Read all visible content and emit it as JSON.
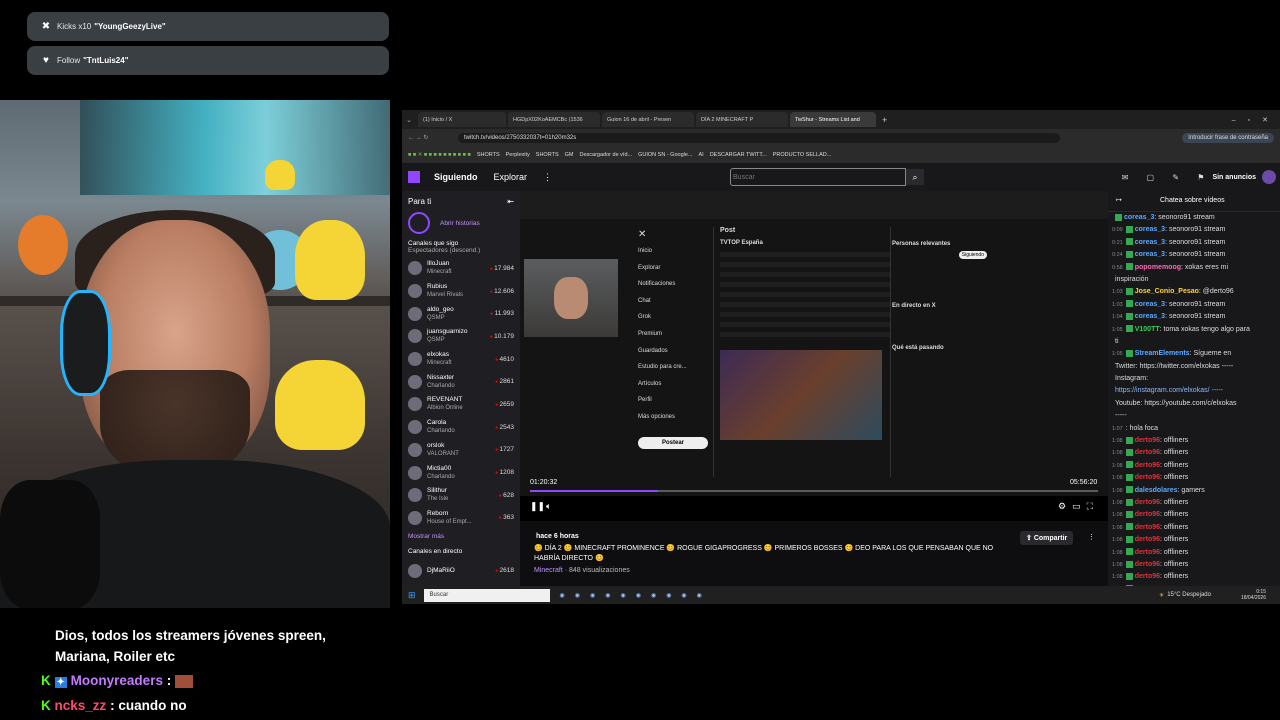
{
  "alerts": [
    {
      "icon": "x-circle-icon",
      "prefix": "Kicks x10",
      "user": "\"YoungGeezyLive\""
    },
    {
      "icon": "heart-icon",
      "prefix": "Follow",
      "user": "\"TntLuis24\""
    }
  ],
  "stream_chat": [
    {
      "text": "Dios, todos los streamers jóvenes spreen,"
    },
    {
      "text": "Mariana, Roiler etc"
    },
    {
      "user": "Moonyreaders",
      "sep": ":",
      "user_color": "#c27cff"
    },
    {
      "user": "ncks_zz",
      "sep": ":",
      "msg": "cuando no",
      "user_color": "#ff4a6d"
    }
  ],
  "browser": {
    "tabs": [
      "(1) Inicio / X",
      "HGDpX02KoAEMCBc (1536",
      "Guion 16 de abril - Presen",
      "DÍA 2 MINECRAFT P",
      "TwShur - Streams List and"
    ],
    "url": "twitch.tv/videos/2750332037t=01h20m32s",
    "password_btn": "Introducir frase de contraseña",
    "bookmarks": [
      "SHORTS",
      "Perplexity",
      "SHORTS",
      "GM",
      "Descargador de víd...",
      "GUION SN - Google...",
      "AI",
      "DESCARGAR TWITT...",
      "PRODUCTO SELLAD..."
    ]
  },
  "twitch": {
    "nav": {
      "following": "Siguiendo",
      "browse": "Explorar",
      "search_placeholder": "Buscar",
      "no_ads": "Sin anuncios"
    },
    "sidebar": {
      "for_you": "Para ti",
      "open_history": "Abrir historias",
      "followed": "Canales que sigo",
      "sort": "Espectadores (descend.)",
      "channels": [
        {
          "name": "IlloJuan",
          "game": "Minecraft",
          "viewers": "17.984"
        },
        {
          "name": "Rubius",
          "game": "Marvel Rivals",
          "viewers": "12.606"
        },
        {
          "name": "aldo_geo",
          "game": "QSMP",
          "viewers": "11.993"
        },
        {
          "name": "juansguarnizo",
          "game": "QSMP",
          "viewers": "10.179"
        },
        {
          "name": "elxokas",
          "game": "Minecraft",
          "viewers": "4610"
        },
        {
          "name": "Nissaxter",
          "game": "Charlando",
          "viewers": "2861"
        },
        {
          "name": "REVENANT",
          "game": "Albion Online",
          "viewers": "2659"
        },
        {
          "name": "Carola",
          "game": "Charlando",
          "viewers": "2543"
        },
        {
          "name": "orslok",
          "game": "VALORANT",
          "viewers": "1727"
        },
        {
          "name": "Mictia00",
          "game": "Charlando",
          "viewers": "1208"
        },
        {
          "name": "Silithur",
          "game": "The Isle",
          "viewers": "628"
        },
        {
          "name": "Reborn",
          "game": "House of Empt...",
          "viewers": "363"
        }
      ],
      "show_more": "Mostrar más",
      "live_channels": "Canales en directo",
      "live_first": {
        "name": "DjMaRiiO",
        "viewers": "2618"
      }
    },
    "player": {
      "current_time": "01:20:32",
      "duration": "05:56:20",
      "progress": 0.225
    },
    "video": {
      "age": "hace 6 horas",
      "title": "😊 DÍA 2 😊 MINECRAFT PROMINENCE 😊 ROGUE GIGAPROGRESS 😊 PRIMEROS BOSSES 😊 DEO PARA LOS QUE PENSABAN QUE NO HABRÍA DIRECTO 😊",
      "game": "Minecraft",
      "views": "· 848 visualizaciones",
      "share": "Compartir"
    },
    "xpage": {
      "menu": [
        "Inicio",
        "Explorar",
        "Notificaciones",
        "Chat",
        "Grok",
        "Premium",
        "Guardados",
        "Estudio para cre...",
        "Artículos",
        "Perfil",
        "Más opciones"
      ],
      "post_btn": "Postear",
      "post_header": "Post",
      "account": "TVTOP España",
      "relevant": "Personas relevantes",
      "follow": "Siguiendo",
      "live_on_x": "En directo en X",
      "whats_happening": "Qué está pasando"
    },
    "chat": {
      "title": "Chatea sobre vídeos",
      "lines": [
        {
          "time": "",
          "user": "coreas_3",
          "msg": ": seonoro91  stream",
          "color": "#5fa8ff"
        },
        {
          "time": "0:09",
          "user": "coreas_3",
          "msg": ": seonoro91  stream",
          "color": "#5fa8ff"
        },
        {
          "time": "0:21",
          "user": "coreas_3",
          "msg": ": seonoro91  stream",
          "color": "#5fa8ff"
        },
        {
          "time": "0:24",
          "user": "coreas_3",
          "msg": ": seonoro91  stream",
          "color": "#5fa8ff"
        },
        {
          "time": "0:58",
          "user": "popomemoog",
          "msg": ": xokas eres mi",
          "color": "#ff69b4"
        },
        {
          "time": "",
          "user": "",
          "msg": "inspiración",
          "color": "#ddd"
        },
        {
          "time": "1:03",
          "user": "Jose_Conio_Pesao",
          "msg": ": @derto96",
          "color": "#ffd23f"
        },
        {
          "time": "1:03",
          "user": "coreas_3",
          "msg": ": seonoro91  stream",
          "color": "#5fa8ff"
        },
        {
          "time": "1:04",
          "user": "coreas_3",
          "msg": ": seonoro91  stream",
          "color": "#5fa8ff"
        },
        {
          "time": "1:05",
          "user": "V100TT",
          "msg": ": toma xokas tengo algo para",
          "color": "#34d058"
        },
        {
          "time": "",
          "user": "",
          "msg": "ti",
          "color": "#ddd"
        },
        {
          "time": "1:05",
          "user": "StreamElements",
          "msg": ": Sígueme en",
          "color": "#5fa8ff"
        },
        {
          "time": "",
          "user": "",
          "msg": "Twitter: https://twitter.com/elxokas -----",
          "color": "#ddd"
        },
        {
          "time": "",
          "user": "",
          "msg": "Instagram:",
          "color": "#ddd"
        },
        {
          "time": "",
          "user": "",
          "msg": "https://instagram.com/elxokas/ -----",
          "color": "#8fb8ff"
        },
        {
          "time": "",
          "user": "",
          "msg": "Youtube: https://youtube.com/c/elxokas",
          "color": "#ddd"
        },
        {
          "time": "",
          "user": "",
          "msg": "-----",
          "color": "#ddd"
        },
        {
          "time": "1:07",
          "user": "",
          "msg": ": hola foca",
          "color": "#ddd"
        },
        {
          "time": "1:08",
          "user": "derto96",
          "msg": ": offliners",
          "color": "#e0303a"
        },
        {
          "time": "1:08",
          "user": "derto96",
          "msg": ": offliners",
          "color": "#e0303a"
        },
        {
          "time": "1:08",
          "user": "derto96",
          "msg": ": offliners",
          "color": "#e0303a"
        },
        {
          "time": "1:08",
          "user": "derto96",
          "msg": ": offliners",
          "color": "#e0303a"
        },
        {
          "time": "1:08",
          "user": "dalesdolares",
          "msg": ": gamers",
          "color": "#5fa8ff"
        },
        {
          "time": "1:08",
          "user": "derto96",
          "msg": ": offliners",
          "color": "#e0303a"
        },
        {
          "time": "1:08",
          "user": "derto96",
          "msg": ": offliners",
          "color": "#e0303a"
        },
        {
          "time": "1:08",
          "user": "derto96",
          "msg": ": offliners",
          "color": "#e0303a"
        },
        {
          "time": "1:08",
          "user": "derto96",
          "msg": ": offliners",
          "color": "#e0303a"
        },
        {
          "time": "1:08",
          "user": "derto96",
          "msg": ": offliners",
          "color": "#e0303a"
        },
        {
          "time": "1:08",
          "user": "derto96",
          "msg": ": offliners",
          "color": "#e0303a"
        },
        {
          "time": "1:08",
          "user": "derto96",
          "msg": ": offliners",
          "color": "#e0303a"
        },
        {
          "time": "1:08",
          "user": "derto96",
          "msg": ": offliners",
          "color": "#e0303a"
        }
      ]
    }
  },
  "taskbar": {
    "search": "Buscar",
    "weather": "15°C  Despejado",
    "time": "0:15",
    "date": "18/04/2026"
  }
}
